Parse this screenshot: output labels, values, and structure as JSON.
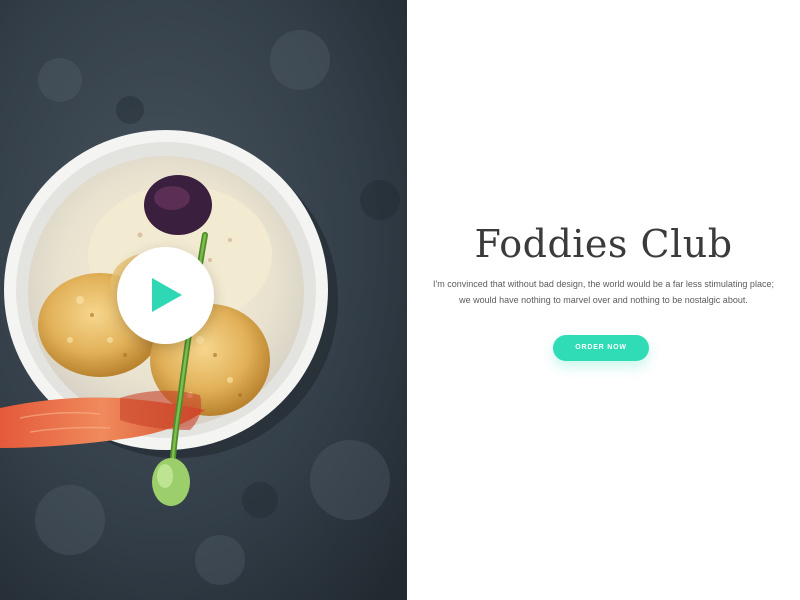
{
  "hero": {
    "play_icon": "play-icon",
    "accent_color": "#2fd8b5"
  },
  "content": {
    "title": "Foddies Club",
    "description_line1": "I'm convinced that without bad design, the world would be a far less stimulating place;",
    "description_line2": "we would have nothing to marvel over and nothing to be nostalgic about.",
    "order_button_label": "ORDER NOW",
    "button_color": "#2fdcb6"
  }
}
